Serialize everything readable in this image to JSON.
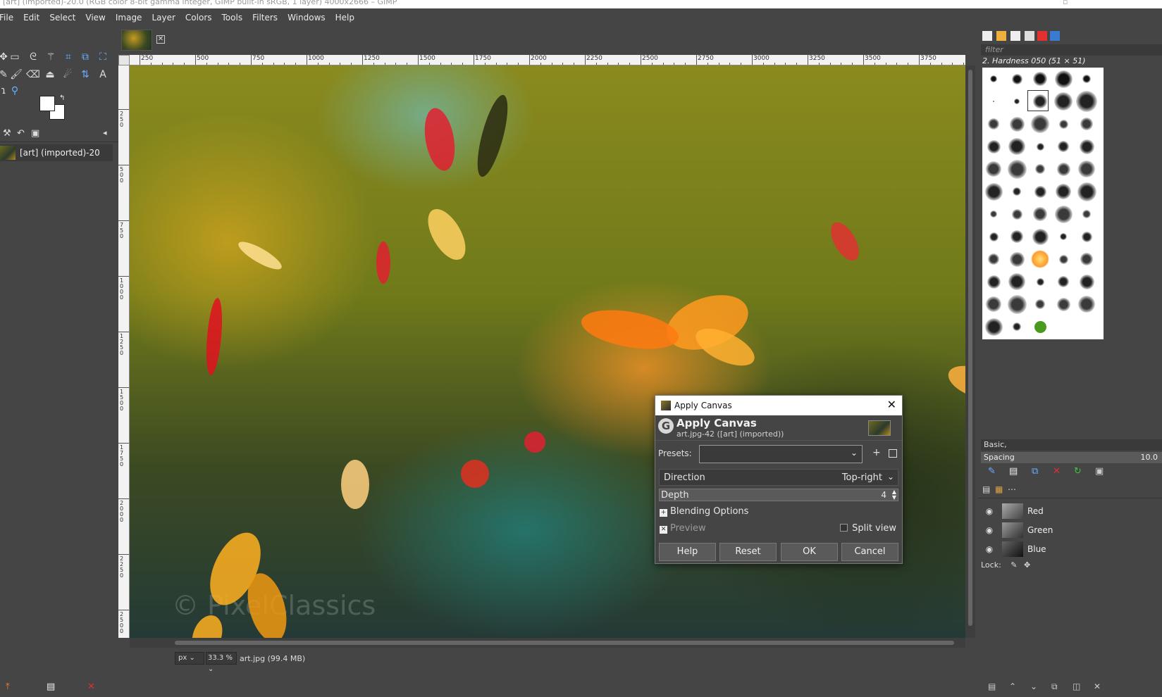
{
  "window": {
    "title": "[art] (imported)-20.0 (RGB color 8-bit gamma integer, GIMP built-in sRGB, 1 layer) 4000x2666 – GIMP"
  },
  "menu": [
    "File",
    "Edit",
    "Select",
    "View",
    "Image",
    "Layer",
    "Colors",
    "Tools",
    "Filters",
    "Windows",
    "Help"
  ],
  "left_dock": {
    "image_list_item": "[art] (imported)-20"
  },
  "rulers": {
    "horizontal_labels": [
      "250",
      "500",
      "750",
      "1000",
      "1250",
      "1500",
      "1750",
      "2000",
      "2250",
      "2500",
      "2750",
      "3000",
      "3250",
      "3500",
      "3750"
    ],
    "vertical_labels": [
      "250",
      "500",
      "750",
      "1000",
      "1250",
      "1500",
      "1750",
      "2000",
      "2250",
      "2500"
    ]
  },
  "canvas": {
    "watermark": "© PixelClassics"
  },
  "status_bar": {
    "unit": "px",
    "zoom": "33.3 %",
    "file_info": "art.jpg (99.4 MB)"
  },
  "right_dock": {
    "filter_placeholder": "filter",
    "brush_name": "2. Hardness 050 (51 × 51)",
    "preset_tag": "Basic,",
    "spacing_label": "Spacing",
    "spacing_value": "10.0",
    "channels": [
      "Red",
      "Green",
      "Blue"
    ],
    "lock_label": "Lock:"
  },
  "dialog": {
    "window_title": "Apply Canvas",
    "heading": "Apply Canvas",
    "subheading": "art.jpg-42 ([art] (imported))",
    "presets_label": "Presets:",
    "direction_label": "Direction",
    "direction_value": "Top-right",
    "depth_label": "Depth",
    "depth_value": "4",
    "blending_label": "Blending Options",
    "preview_label": "Preview",
    "split_view_label": "Split view",
    "buttons": {
      "help": "Help",
      "reset": "Reset",
      "ok": "OK",
      "cancel": "Cancel"
    }
  }
}
